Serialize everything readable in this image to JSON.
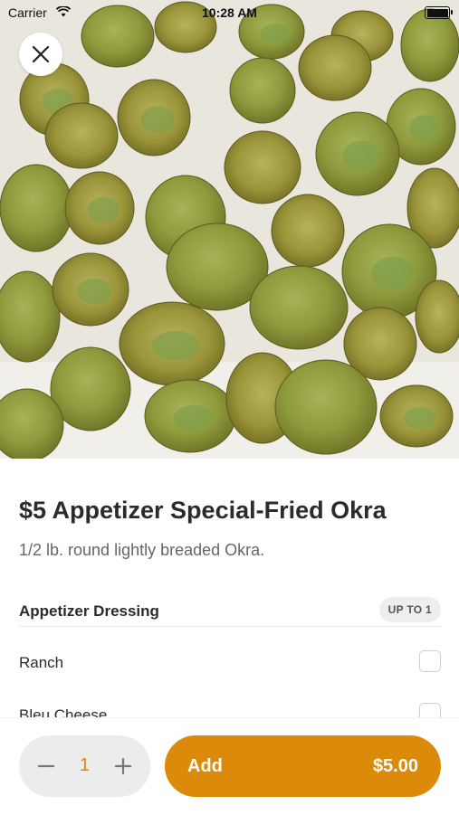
{
  "status_bar": {
    "carrier": "Carrier",
    "time": "10:28 AM"
  },
  "hero": {
    "alt": "Fried okra photo"
  },
  "item": {
    "title": "$5 Appetizer Special-Fried Okra",
    "description": "1/2 lb. round lightly breaded Okra."
  },
  "section": {
    "title": "Appetizer Dressing",
    "badge": "UP TO 1",
    "options": [
      {
        "label": "Ranch",
        "checked": false
      },
      {
        "label": "Bleu Cheese",
        "checked": false
      }
    ]
  },
  "footer": {
    "quantity": "1",
    "add_label": "Add",
    "price": "$5.00"
  },
  "colors": {
    "accent": "#db8a09",
    "qty_text": "#d6890a",
    "close_bg": "#ffffff"
  },
  "icons": {
    "close": "close-icon",
    "minus": "minus-icon",
    "plus": "plus-icon",
    "wifi": "wifi-icon"
  }
}
